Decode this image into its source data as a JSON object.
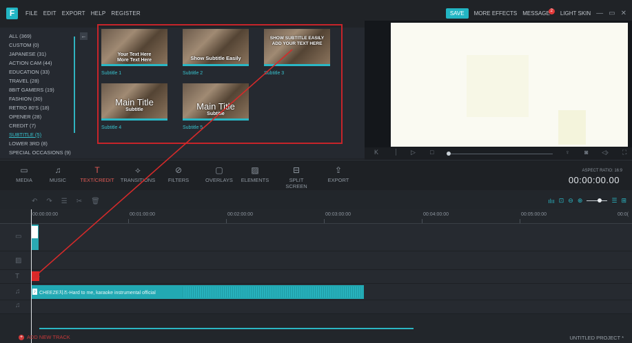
{
  "app": {
    "logo_letter": "F",
    "menu": [
      "FILE",
      "EDIT",
      "EXPORT",
      "HELP",
      "REGISTER"
    ],
    "save_label": "SAVE",
    "more_effects_label": "MORE EFFECTS",
    "message_label": "MESSAGE",
    "message_count": "2",
    "light_skin_label": "LIGHT SKIN"
  },
  "categories": [
    {
      "label": "ALL (369)"
    },
    {
      "label": "CUSTOM (0)"
    },
    {
      "label": "JAPANESE (31)"
    },
    {
      "label": "ACTION CAM (44)"
    },
    {
      "label": "EDUCATION (33)"
    },
    {
      "label": "TRAVEL (28)"
    },
    {
      "label": "8BIT GAMERS (19)"
    },
    {
      "label": "FASHION (30)"
    },
    {
      "label": "RETRO 80'S (18)"
    },
    {
      "label": "OPENER (28)"
    },
    {
      "label": "CREDIT (7)"
    },
    {
      "label": "SUBTITLE (5)",
      "active": true
    },
    {
      "label": "LOWER 3RD (8)"
    },
    {
      "label": "SPECIAL OCCASIONS (9)"
    }
  ],
  "thumbnails": [
    {
      "label": "Subtitle 1",
      "line1": "Your Text Here",
      "line2": "More Text Here"
    },
    {
      "label": "Subtitle 2",
      "line1": "Show Subtitle Easily",
      "line2": ""
    },
    {
      "label": "Subtitle 3",
      "line1": "SHOW SUBTITLE EASILY",
      "line2": "ADD YOUR TEXT HERE"
    },
    {
      "label": "Subtitle 4",
      "line1": "Main Title",
      "line2": "Subtitle"
    },
    {
      "label": "Subtitle 5",
      "line1": "Main Title",
      "line2": "Subtitle"
    }
  ],
  "toolbar": [
    {
      "label": "MEDIA",
      "icon": "folder-icon"
    },
    {
      "label": "MUSIC",
      "icon": "music-icon"
    },
    {
      "label": "TEXT/CREDIT",
      "icon": "text-icon",
      "active": true
    },
    {
      "label": "TRANSITIONS",
      "icon": "transitions-icon"
    },
    {
      "label": "FILTERS",
      "icon": "filters-icon"
    },
    {
      "label": "OVERLAYS",
      "icon": "overlays-icon"
    },
    {
      "label": "ELEMENTS",
      "icon": "elements-icon"
    },
    {
      "label": "SPLIT SCREEN",
      "icon": "split-screen-icon"
    },
    {
      "label": "EXPORT",
      "icon": "export-icon"
    }
  ],
  "preview": {
    "aspect_ratio": "ASPECT RATIO: 16:9",
    "timecode": "00:00:00.00"
  },
  "timeline": {
    "ruler": [
      "00:00:00:00",
      "00:01:00:00",
      "00:02:00:00",
      "00:03:00:00",
      "00:04:00:00",
      "00:05:00:00",
      "00:0("
    ],
    "audio_clip": "CHEEZE치즈-Hard to me, karaoke instrumental official",
    "add_track_label": "ADD NEW TRACK",
    "project_name": "UNTITLED PROJECT *"
  },
  "colors": {
    "accent": "#22b5c3",
    "highlight_box": "#c8242a",
    "active_tool": "#e05a55"
  }
}
